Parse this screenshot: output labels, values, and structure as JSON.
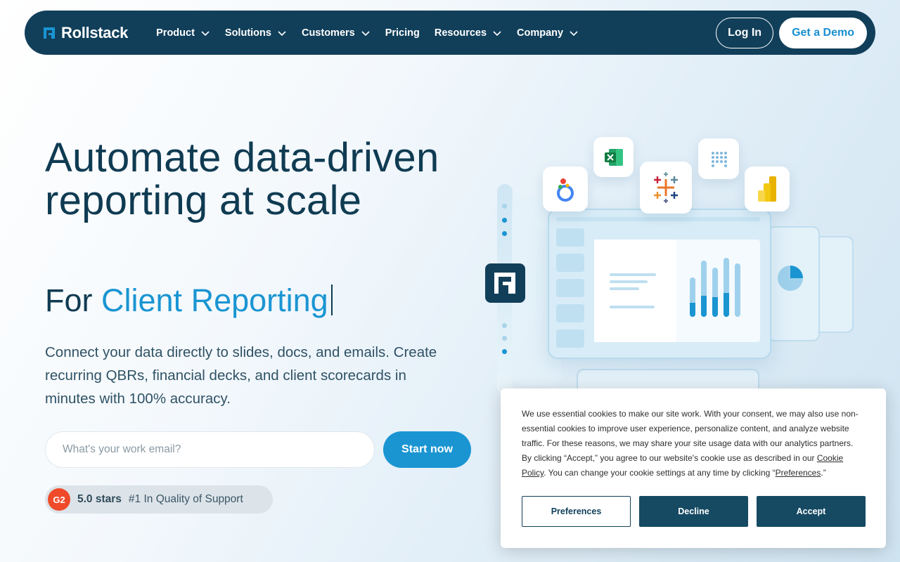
{
  "brand": {
    "name": "Rollstack",
    "color": "#113f5a",
    "accent": "#1a95d2"
  },
  "nav": {
    "items": [
      {
        "label": "Product",
        "has_dropdown": true
      },
      {
        "label": "Solutions",
        "has_dropdown": true
      },
      {
        "label": "Customers",
        "has_dropdown": true
      },
      {
        "label": "Pricing",
        "has_dropdown": false
      },
      {
        "label": "Resources",
        "has_dropdown": true
      },
      {
        "label": "Company",
        "has_dropdown": true
      }
    ],
    "login_label": "Log In",
    "demo_label": "Get a Demo"
  },
  "hero": {
    "title": "Automate data-driven reporting at scale",
    "sub_prefix": "For ",
    "sub_accent": "Client Reporting",
    "description": "Connect your data directly to slides, docs, and emails. Create recurring QBRs, financial decks, and client scorecards in minutes with 100% accuracy.",
    "email_placeholder": "What's your work email?",
    "email_value": "",
    "start_label": "Start now"
  },
  "rating": {
    "badge": "G2",
    "stars": "5.0 stars",
    "text": "#1 In Quality of Support"
  },
  "integrations": [
    "looker-icon",
    "excel-icon",
    "tableau-icon",
    "metabase-icon",
    "power-bi-icon"
  ],
  "cookie": {
    "text_1": "We use essential cookies to make our site work. With your consent, we may also use non-essential cookies to improve user experience, personalize content, and analyze website traffic. For these reasons, we may share your site usage data with our analytics partners. By clicking “Accept,” you agree to our website's cookie use as described in our ",
    "policy_link": "Cookie Policy",
    "text_2": ". You can change your cookie settings at any time by clicking “",
    "preferences_link": "Preferences",
    "text_3": ".”",
    "preferences_label": "Preferences",
    "decline_label": "Decline",
    "accept_label": "Accept"
  }
}
